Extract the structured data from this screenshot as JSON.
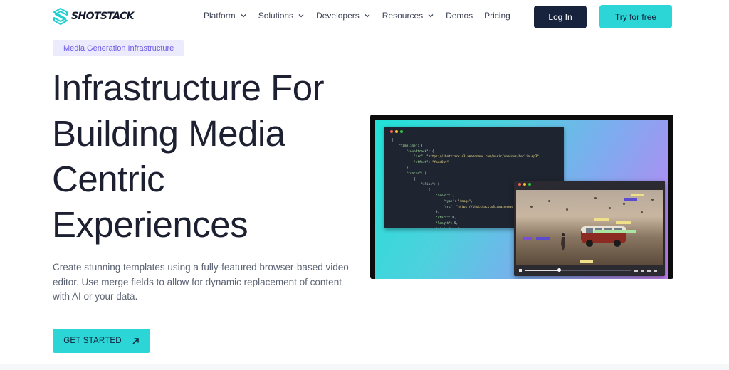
{
  "header": {
    "logo_text": "SHOTSTACK",
    "nav": [
      {
        "label": "Platform",
        "has_dropdown": true,
        "icon": "chevron-down-icon"
      },
      {
        "label": "Solutions",
        "has_dropdown": true,
        "icon": "chevron-down-icon"
      },
      {
        "label": "Developers",
        "has_dropdown": true,
        "icon": "chevron-down-icon"
      },
      {
        "label": "Resources",
        "has_dropdown": true,
        "icon": "chevron-down-icon"
      },
      {
        "label": "Demos",
        "has_dropdown": false
      },
      {
        "label": "Pricing",
        "has_dropdown": false
      }
    ],
    "login_label": "Log In",
    "try_label": "Try for free"
  },
  "hero": {
    "badge": "Media Generation Infrastructure",
    "headline_lines": [
      "Infrastructure For",
      "Building Media",
      "Centric",
      "Experiences"
    ],
    "description": "Create stunning templates using a fully-featured browser-based video editor. Use merge fields to allow for dynamic replacement of content with AI or your data.",
    "cta_label": "GET STARTED",
    "cta_icon": "arrow-up-right-icon"
  },
  "illustration": {
    "video_progress": 0.32
  },
  "colors": {
    "accent": "#2dd6d6",
    "navy": "#17233d",
    "badge_bg": "#ecebfd",
    "badge_text": "#6c5ce7"
  }
}
